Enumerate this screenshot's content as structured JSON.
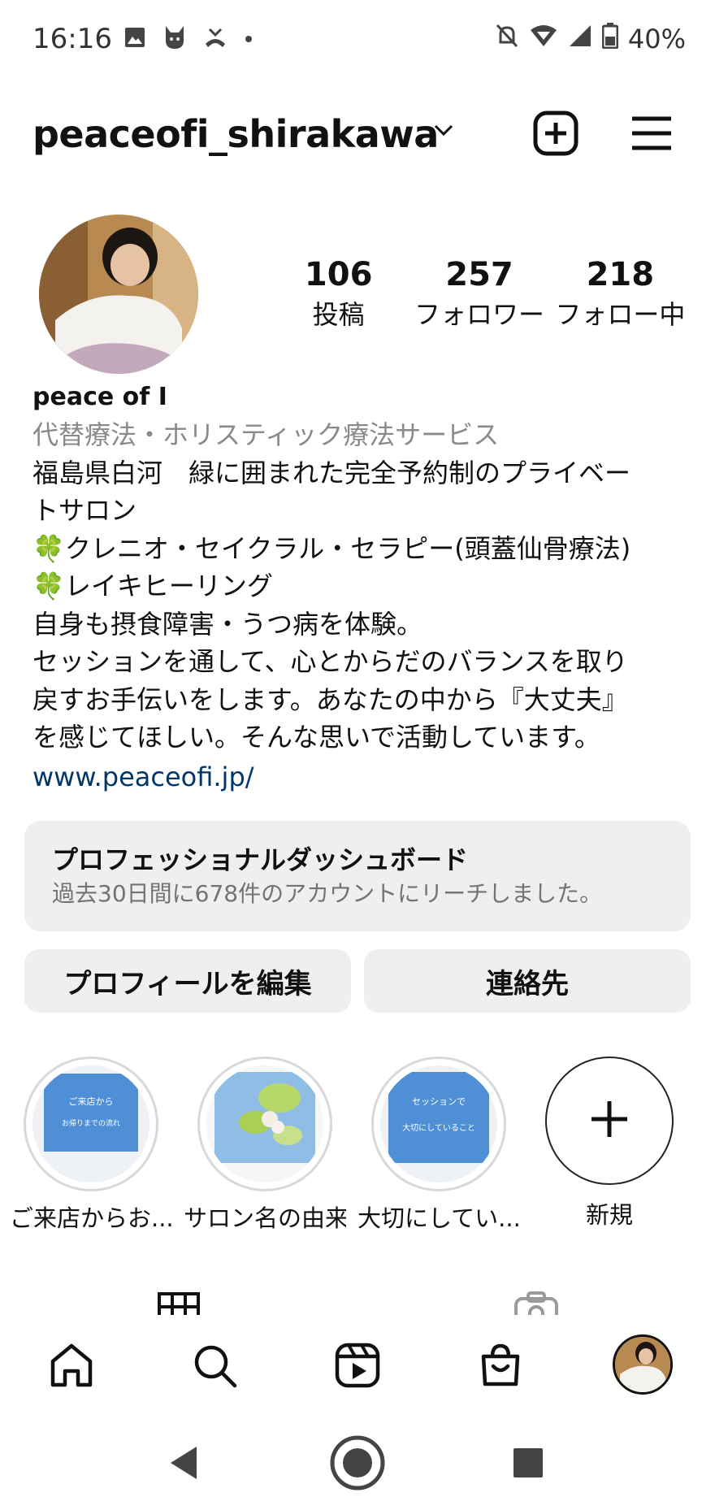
{
  "status_bar": {
    "time": "16:16",
    "battery": "40%",
    "left_icons": [
      "image-icon",
      "cat-icon",
      "missed-call-icon",
      "dot-icon"
    ],
    "right_icons": [
      "bell-off-icon",
      "wifi-icon",
      "signal-icon",
      "battery-icon"
    ]
  },
  "header": {
    "username": "peaceofi_shirakawa"
  },
  "profile": {
    "stats": [
      {
        "value": "106",
        "label": "投稿"
      },
      {
        "value": "257",
        "label": "フォロワー"
      },
      {
        "value": "218",
        "label": "フォロー中"
      }
    ],
    "name": "peace of  I",
    "category": "代替療法・ホリスティック療法サービス",
    "bio_lines": [
      "福島県白河　緑に囲まれた完全予約制のプライベー",
      "トサロン",
      "クレニオ・セイクラル・セラピー(頭蓋仙骨療法)",
      "レイキヒーリング",
      "自身も摂食障害・うつ病を体験。",
      "セッションを通して、心とからだのバランスを取り",
      "戻すお手伝いをします。あなたの中から『大丈夫』",
      "を感じてほしい。そんな思いで活動しています。"
    ],
    "clover": "🍀",
    "link": "www.peaceofi.jp/"
  },
  "dashboard": {
    "title": "プロフェッショナルダッシュボード",
    "subtitle": "過去30日間に678件のアカウントにリーチしました。"
  },
  "buttons": {
    "edit_profile": "プロフィールを編集",
    "contact": "連絡先"
  },
  "highlights": [
    {
      "label": "ご来店からお...",
      "cover_text": [
        "ご来店から",
        "お帰りまでの流れ"
      ],
      "cover_color": "#4f8fd6"
    },
    {
      "label": "サロン名の由来",
      "cover_text": [],
      "cover_color": "#9cc5e8"
    },
    {
      "label": "大切にしてい...",
      "cover_text": [
        "セッションで",
        "大切にしていること"
      ],
      "cover_color": "#4f8fd6"
    }
  ],
  "new_highlight": {
    "label": "新規"
  },
  "colors": {
    "link": "#00376b",
    "button_bg": "#efefef",
    "muted": "#8a8a8a"
  }
}
